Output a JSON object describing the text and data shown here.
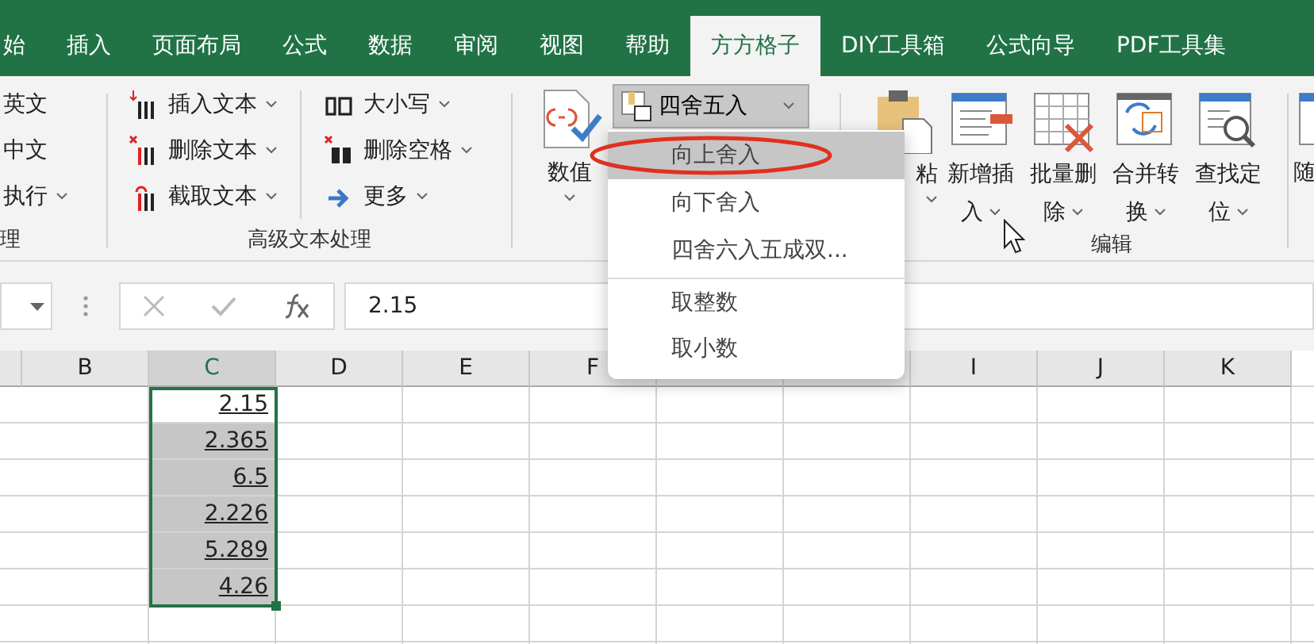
{
  "tabs": [
    {
      "label": "始",
      "selected": false
    },
    {
      "label": "插入",
      "selected": false
    },
    {
      "label": "页面布局",
      "selected": false
    },
    {
      "label": "公式",
      "selected": false
    },
    {
      "label": "数据",
      "selected": false
    },
    {
      "label": "审阅",
      "selected": false
    },
    {
      "label": "视图",
      "selected": false
    },
    {
      "label": "帮助",
      "selected": false
    },
    {
      "label": "方方格子",
      "selected": true
    },
    {
      "label": "DIY工具箱",
      "selected": false
    },
    {
      "label": "公式向导",
      "selected": false
    },
    {
      "label": "PDF工具集",
      "selected": false
    }
  ],
  "ribbon": {
    "left_group": {
      "items": [
        {
          "label": "英文",
          "dropdown": false
        },
        {
          "label": "中文",
          "dropdown": false
        },
        {
          "label": "执行",
          "dropdown": true
        }
      ],
      "label": "理"
    },
    "text_group": {
      "label": "高级文本处理",
      "column_1": [
        {
          "label": "插入文本",
          "kind": "insert"
        },
        {
          "label": "删除文本",
          "kind": "delete"
        },
        {
          "label": "截取文本",
          "kind": "cut"
        }
      ],
      "column_2": [
        {
          "label": "大小写",
          "kind": "case"
        },
        {
          "label": "删除空格",
          "kind": "space"
        },
        {
          "label": "更多",
          "kind": "more"
        }
      ]
    },
    "number_group": {
      "button": "数值",
      "rounding": {
        "label": "四舍五入",
        "pressed": true
      }
    },
    "edit_group": {
      "label": "编辑",
      "buttons": [
        {
          "lines": [
            "粘"
          ],
          "kind": "paste"
        },
        {
          "lines": [
            "新增插",
            "入"
          ],
          "kind": "insert"
        },
        {
          "lines": [
            "批量删",
            "除"
          ],
          "kind": "delete"
        },
        {
          "lines": [
            "合并转",
            "换"
          ],
          "kind": "merge"
        },
        {
          "lines": [
            "查找定",
            "位"
          ],
          "kind": "find"
        }
      ]
    },
    "extra_button": "随"
  },
  "menu": {
    "items": [
      {
        "label": "向上舍入",
        "selected": true,
        "circled": true,
        "separator_before": false
      },
      {
        "label": "向下舍入",
        "selected": false,
        "circled": false,
        "separator_before": false
      },
      {
        "label": "四舍六入五成双...",
        "selected": false,
        "circled": false,
        "separator_before": false
      },
      {
        "label": "取整数",
        "selected": false,
        "circled": false,
        "separator_before": true
      },
      {
        "label": "取小数",
        "selected": false,
        "circled": false,
        "separator_before": false
      }
    ]
  },
  "formula_bar": {
    "value": "2.15"
  },
  "columns": [
    {
      "label": "B",
      "selected": false
    },
    {
      "label": "C",
      "selected": true
    },
    {
      "label": "D",
      "selected": false
    },
    {
      "label": "E",
      "selected": false
    },
    {
      "label": "F",
      "selected": false
    },
    {
      "covered": true,
      "selected": false
    },
    {
      "covered": true,
      "selected": false
    },
    {
      "label": "I",
      "selected": false
    },
    {
      "label": "J",
      "selected": false
    },
    {
      "label": "K",
      "selected": false
    }
  ],
  "rows": [
    {
      "c": "2.15",
      "selected": false
    },
    {
      "c": "2.365",
      "selected": true
    },
    {
      "c": "6.5",
      "selected": true
    },
    {
      "c": "2.226",
      "selected": true
    },
    {
      "c": "5.289",
      "selected": true
    },
    {
      "c": "4.26",
      "selected": true
    }
  ]
}
